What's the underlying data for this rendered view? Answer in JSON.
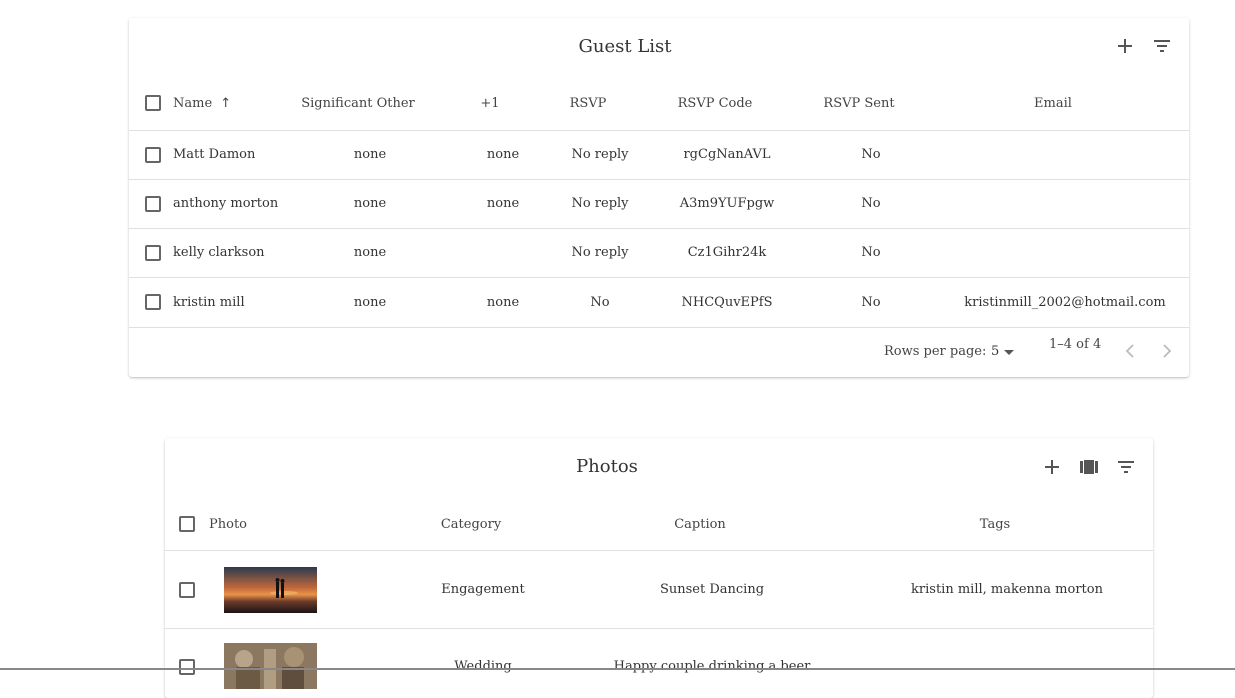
{
  "guest_list": {
    "title": "Guest List",
    "columns": {
      "name": "Name",
      "significant_other": "Significant Other",
      "plus_one": "+1",
      "rsvp": "RSVP",
      "rsvp_code": "RSVP Code",
      "rsvp_sent": "RSVP Sent",
      "email": "Email"
    },
    "sort_indicator": "↑",
    "rows": [
      {
        "name": "Matt Damon",
        "significant_other": "none",
        "plus_one": "none",
        "rsvp": "No reply",
        "rsvp_code": "rgCgNanAVL",
        "rsvp_sent": "No",
        "email": ""
      },
      {
        "name": "anthony morton",
        "significant_other": "none",
        "plus_one": "none",
        "rsvp": "No reply",
        "rsvp_code": "A3m9YUFpgw",
        "rsvp_sent": "No",
        "email": ""
      },
      {
        "name": "kelly clarkson",
        "significant_other": "none",
        "plus_one": "",
        "rsvp": "No reply",
        "rsvp_code": "Cz1Gihr24k",
        "rsvp_sent": "No",
        "email": ""
      },
      {
        "name": "kristin mill",
        "significant_other": "none",
        "plus_one": "none",
        "rsvp": "No",
        "rsvp_code": "NHCQuvEPfS",
        "rsvp_sent": "No",
        "email": "kristinmill_2002@hotmail.com"
      }
    ],
    "pagination": {
      "rows_per_page_label": "Rows per page:",
      "rows_per_page_value": "5",
      "range": "1–4 of 4"
    }
  },
  "photos": {
    "title": "Photos",
    "columns": {
      "photo": "Photo",
      "category": "Category",
      "caption": "Caption",
      "tags": "Tags"
    },
    "rows": [
      {
        "category": "Engagement",
        "caption": "Sunset Dancing",
        "tags": "kristin mill, makenna morton"
      },
      {
        "category": "Wedding",
        "caption": "Happy couple drinking a beer",
        "tags": ""
      }
    ]
  },
  "icons": {
    "add": "plus-icon",
    "filter": "filter-list-icon",
    "columns": "view-column-icon",
    "sort": "arrow-up-icon",
    "prev": "chevron-left-icon",
    "next": "chevron-right-icon",
    "dropdown": "caret-down-icon"
  }
}
